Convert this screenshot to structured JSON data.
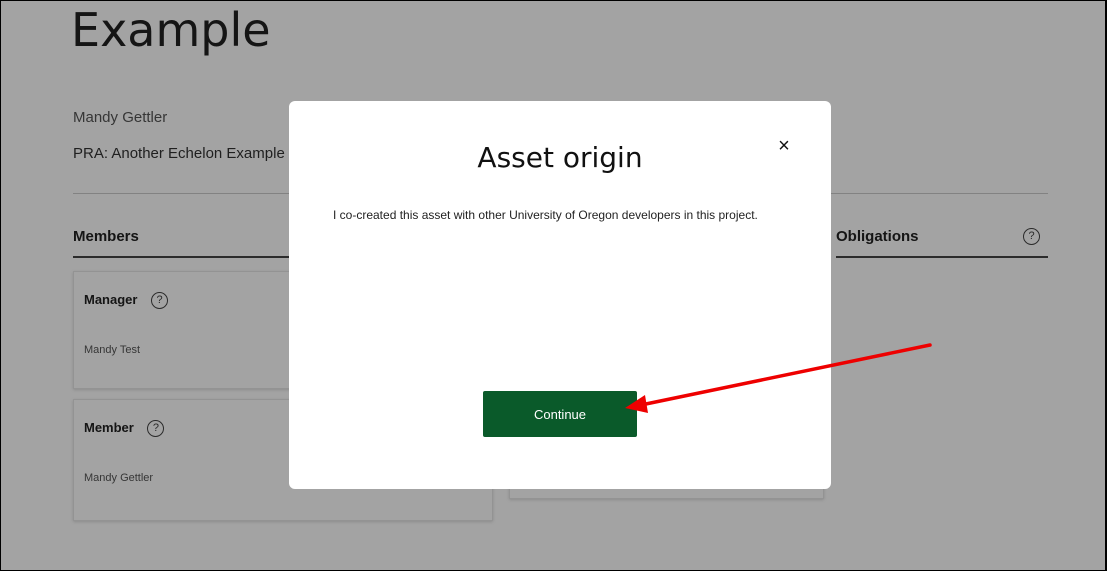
{
  "page": {
    "title": "Example",
    "owner": "Mandy Gettler",
    "project": "PRA: Another Echelon Example"
  },
  "sections": {
    "members": "Members",
    "obligations": "Obligations"
  },
  "cards": [
    {
      "role": "Manager",
      "person": "Mandy Test"
    },
    {
      "role": "Member",
      "person": "Mandy Gettler"
    }
  ],
  "icons": {
    "help": "?",
    "close": "×"
  },
  "modal": {
    "title": "Asset origin",
    "body": "I co-created this asset with other University of Oregon developers in this project.",
    "continue_label": "Continue"
  },
  "colors": {
    "primary_button": "#0a5a2a",
    "annotation_arrow": "#ee0000"
  }
}
